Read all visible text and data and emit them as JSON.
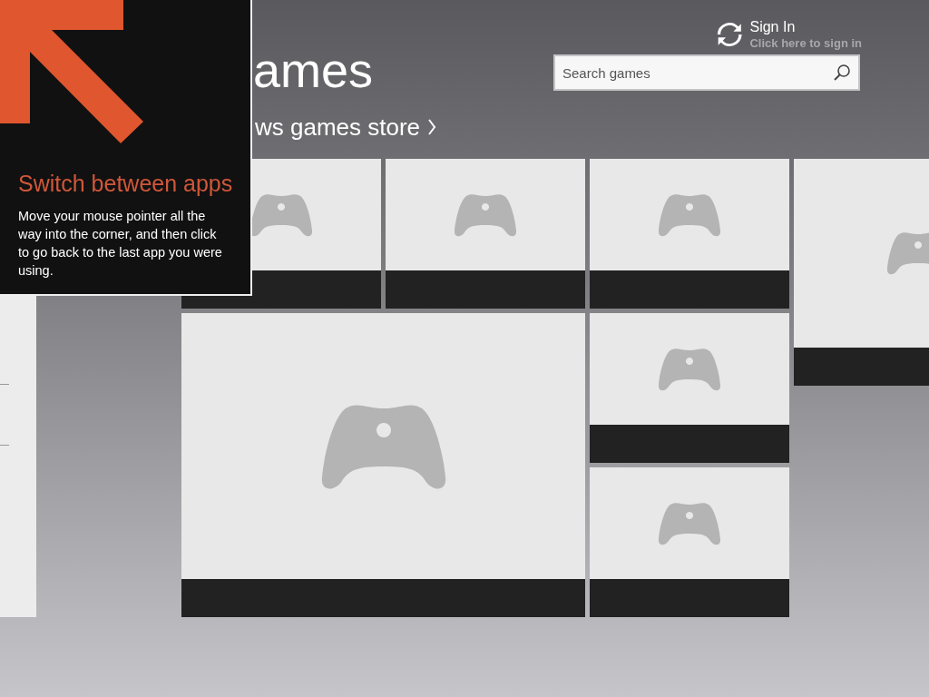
{
  "header": {
    "title": "ames",
    "store_link": "ws games store"
  },
  "sign_in": {
    "title": "Sign In",
    "subtitle": "Click here to sign in"
  },
  "search": {
    "placeholder": "Search games"
  },
  "tiles": [
    {
      "kind": "small"
    },
    {
      "kind": "small"
    },
    {
      "kind": "small"
    },
    {
      "kind": "large"
    },
    {
      "kind": "small"
    },
    {
      "kind": "small"
    }
  ],
  "side_tile": {
    "kind": "tall"
  },
  "tip": {
    "title": "Switch between apps",
    "body": "Move your mouse pointer all the way into the corner, and then click to go back to the last app you were using."
  }
}
